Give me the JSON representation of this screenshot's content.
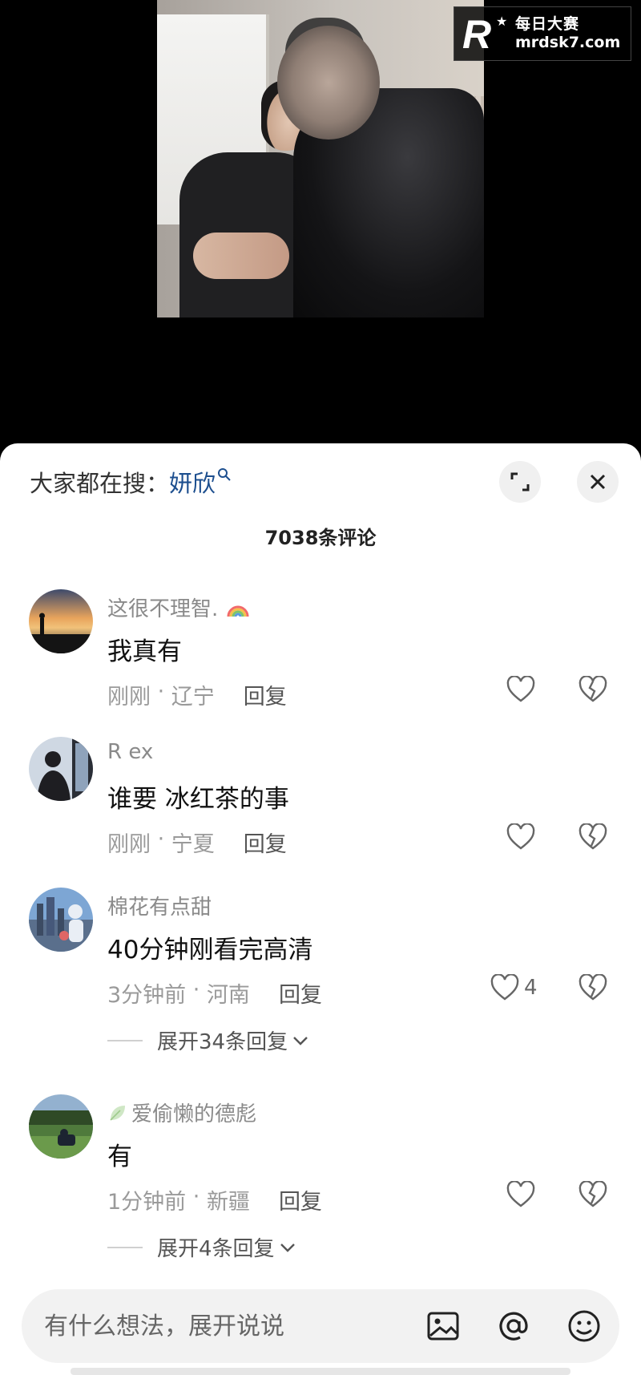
{
  "watermark": {
    "logo_letter": "R",
    "title": "每日大赛",
    "url": "mrdsk7.com"
  },
  "sheet": {
    "search_prefix": "大家都在搜：",
    "search_term": "妍欣",
    "comment_count_title": "7038条评论"
  },
  "comments": [
    {
      "username": "这很不理智.",
      "user_suffix_icon": "rainbow-icon",
      "text": "我真有",
      "time": "刚刚",
      "location": "辽宁",
      "reply_label": "回复",
      "likes": ""
    },
    {
      "username": "R  ex",
      "text": "谁要 冰红茶的事",
      "time": "刚刚",
      "location": "宁夏",
      "reply_label": "回复",
      "likes": ""
    },
    {
      "username": "棉花有点甜",
      "text": "40分钟刚看完高清",
      "time": "3分钟前",
      "location": "河南",
      "reply_label": "回复",
      "likes": "4",
      "expand_label": "展开34条回复"
    },
    {
      "username": "爱偷懒的德彪",
      "user_prefix_icon": "leaf-icon",
      "text": "有",
      "time": "1分钟前",
      "location": "新疆",
      "reply_label": "回复",
      "likes": "",
      "expand_label": "展开4条回复"
    }
  ],
  "input": {
    "placeholder": "有什么想法，展开说说"
  },
  "colors": {
    "search_term": "#1d4f8f",
    "sheet_bg": "#ffffff",
    "meta_gray": "#9a9a9a"
  }
}
